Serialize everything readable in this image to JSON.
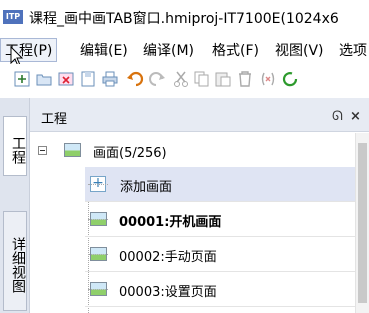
{
  "window": {
    "app_icon_text": "ITP",
    "title": "课程_画中画TAB窗口.hmiproj-IT7100E(1024x6"
  },
  "menu": {
    "items": [
      {
        "label": "工程(P)"
      },
      {
        "label": "编辑(E)"
      },
      {
        "label": "编译(M)"
      },
      {
        "label": "格式(F)"
      },
      {
        "label": "视图(V)"
      },
      {
        "label": "选项"
      }
    ]
  },
  "toolbar": {
    "icons": [
      "new-icon",
      "open-icon",
      "close-project-icon",
      "save-icon",
      "print-icon",
      "undo-icon",
      "redo-icon",
      "cut-icon",
      "copy-icon",
      "paste-icon",
      "delete-icon",
      "symbol-icon",
      "refresh-icon"
    ]
  },
  "side_tabs": {
    "project": "工程",
    "detail": "详细视图"
  },
  "panel": {
    "title": "工程",
    "float_glyph": "ᘏ",
    "close_glyph": "×"
  },
  "tree": {
    "root_label": "画面(5/256)",
    "add_label": "添加画面",
    "screens": [
      {
        "label": "00001:开机画面",
        "bold": true
      },
      {
        "label": "00002:手动页面",
        "bold": false
      },
      {
        "label": "00003:设置页面",
        "bold": false
      }
    ]
  },
  "colors": {
    "selected_row": "#dfe4f3",
    "panel_header": "#e7ebf3",
    "side_tab_bg": "#dfe4ee",
    "app_icon": "#4f72bc"
  }
}
